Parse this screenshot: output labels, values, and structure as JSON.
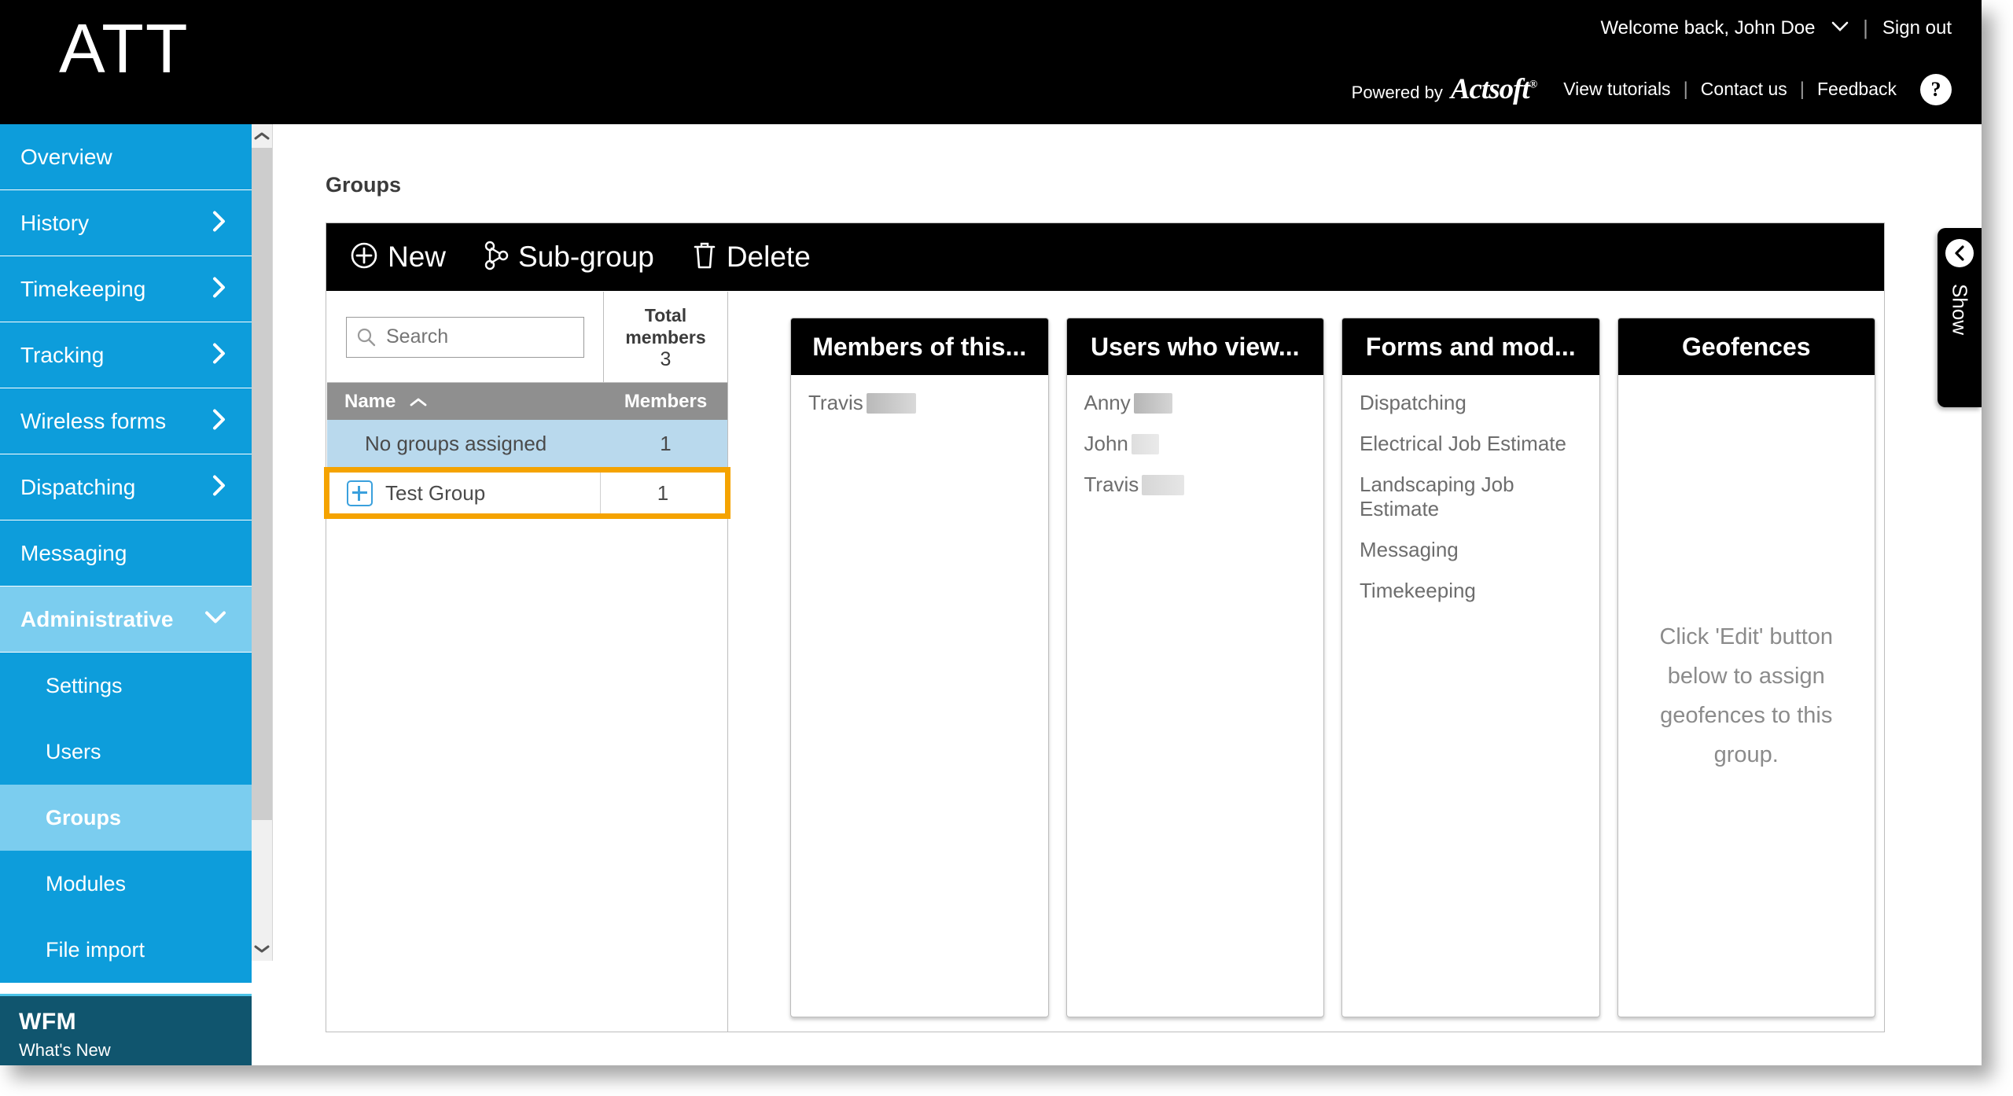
{
  "header": {
    "logo": "ATT",
    "welcome": "Welcome back, John Doe",
    "sign_out": "Sign out",
    "powered_by": "Powered by",
    "brand": "Actsoft",
    "view_tutorials": "View tutorials",
    "contact_us": "Contact us",
    "feedback": "Feedback",
    "help": "?",
    "separator": "|"
  },
  "sidebar": {
    "items": [
      {
        "label": "Overview",
        "has_arrow": false,
        "state": "normal"
      },
      {
        "label": "History",
        "has_arrow": true,
        "state": "normal"
      },
      {
        "label": "Timekeeping",
        "has_arrow": true,
        "state": "normal"
      },
      {
        "label": "Tracking",
        "has_arrow": true,
        "state": "normal"
      },
      {
        "label": "Wireless forms",
        "has_arrow": true,
        "state": "normal"
      },
      {
        "label": "Dispatching",
        "has_arrow": true,
        "state": "normal"
      },
      {
        "label": "Messaging",
        "has_arrow": false,
        "state": "normal"
      },
      {
        "label": "Administrative",
        "has_arrow": true,
        "state": "expanded"
      }
    ],
    "sub_items": [
      {
        "label": "Settings",
        "selected": false
      },
      {
        "label": "Users",
        "selected": false
      },
      {
        "label": "Groups",
        "selected": true
      },
      {
        "label": "Modules",
        "selected": false
      },
      {
        "label": "File import",
        "selected": false
      }
    ],
    "footer": {
      "title": "WFM",
      "subtitle": "What's New"
    }
  },
  "main": {
    "page_title": "Groups",
    "toolbar": [
      {
        "label": "New",
        "icon": "plus-circle-icon"
      },
      {
        "label": "Sub-group",
        "icon": "branch-icon"
      },
      {
        "label": "Delete",
        "icon": "trash-icon"
      }
    ],
    "search": {
      "placeholder": "Search",
      "value": "",
      "icon": "search-icon"
    },
    "total_members": {
      "label_line1": "Total",
      "label_line2": "members",
      "count": "3"
    },
    "columns": {
      "name": "Name",
      "members": "Members",
      "sort": "ascending"
    },
    "rows": [
      {
        "name": "No groups assigned",
        "members": "1",
        "expandable": false,
        "selected": true,
        "highlighted": false
      },
      {
        "name": "Test Group",
        "members": "1",
        "expandable": true,
        "selected": false,
        "highlighted": true
      }
    ],
    "highlight_color": "#f5a300",
    "accent_color": "#0d9ddb",
    "cards": [
      {
        "title": "Members of this...",
        "type": "list",
        "items": [
          {
            "text": "Travis",
            "redacted_width": 63
          }
        ]
      },
      {
        "title": "Users who view...",
        "type": "list",
        "items": [
          {
            "text": "Anny",
            "redacted_width": 49
          },
          {
            "text": "John",
            "redacted_width": 35
          },
          {
            "text": "Travis",
            "redacted_width": 54
          }
        ]
      },
      {
        "title": "Forms and mod...",
        "type": "list",
        "items": [
          {
            "text": "Dispatching",
            "redacted_width": 0
          },
          {
            "text": "Electrical Job Estimate",
            "redacted_width": 0
          },
          {
            "text": "Landscaping Job Estimate",
            "redacted_width": 0
          },
          {
            "text": "Messaging",
            "redacted_width": 0
          },
          {
            "text": "Timekeeping",
            "redacted_width": 0
          }
        ]
      },
      {
        "title": "Geofences",
        "type": "message",
        "message": "Click 'Edit' button below to assign geofences to this group."
      }
    ]
  },
  "show_tab": {
    "label": "Show",
    "icon": "arrow-left-circle-icon"
  }
}
